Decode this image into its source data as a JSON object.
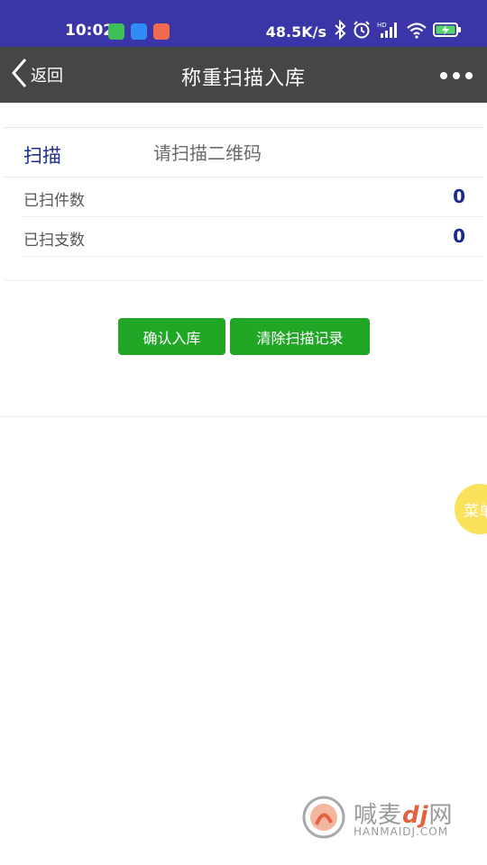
{
  "status_bar": {
    "time": "10:02",
    "net_speed": "48.5K/s",
    "app_icon_colors": [
      "#3fbf5a",
      "#2f8bf5",
      "#ef6a4f"
    ],
    "icons": [
      "bluetooth-icon",
      "alarm-icon",
      "hd-signal-icon",
      "wifi-icon",
      "battery-charging-icon"
    ]
  },
  "nav": {
    "back_label": "返回",
    "title": "称重扫描入库"
  },
  "form": {
    "scan_label": "扫描",
    "scan_placeholder": "请扫描二维码",
    "rows": [
      {
        "label": "已扫件数",
        "value": "0"
      },
      {
        "label": "已扫支数",
        "value": "0"
      }
    ]
  },
  "buttons": {
    "confirm": "确认入库",
    "clear": "清除扫描记录"
  },
  "float_menu": {
    "label": "菜单"
  },
  "watermark": {
    "text_cn": "喊麦",
    "logo_text": "dj",
    "text_cn_suffix": "网",
    "text_en": "HANMAIDJ.COM"
  },
  "colors": {
    "status_bar": "#3a36a8",
    "nav_bar": "#464646",
    "button": "#22a626",
    "value_text": "#1a2a8c",
    "float_menu": "#fbe25c"
  }
}
